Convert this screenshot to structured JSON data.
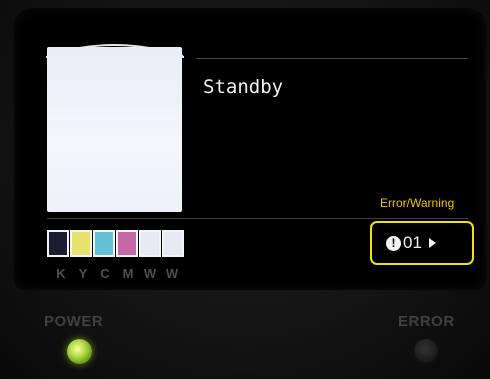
{
  "screen": {
    "status_text": "Standby"
  },
  "error_warning": {
    "label": "Error/Warning",
    "icon": "exclamation-icon",
    "code": "01",
    "arrow_icon": "play-arrow-icon"
  },
  "ink_cartridges": [
    {
      "letter": "K",
      "color": "#1a1e30"
    },
    {
      "letter": "Y",
      "color": "#e6e26a"
    },
    {
      "letter": "C",
      "color": "#62c1d6"
    },
    {
      "letter": "M",
      "color": "#c568a8"
    },
    {
      "letter": "W",
      "color": "#e6eaf2"
    },
    {
      "letter": "W",
      "color": "#e6eaf2"
    }
  ],
  "indicators": {
    "power_label": "POWER",
    "error_label": "ERROR",
    "power_led_color": "#b7e04b"
  },
  "colors": {
    "accent": "#f1e400",
    "label_text": "#f0c400"
  }
}
